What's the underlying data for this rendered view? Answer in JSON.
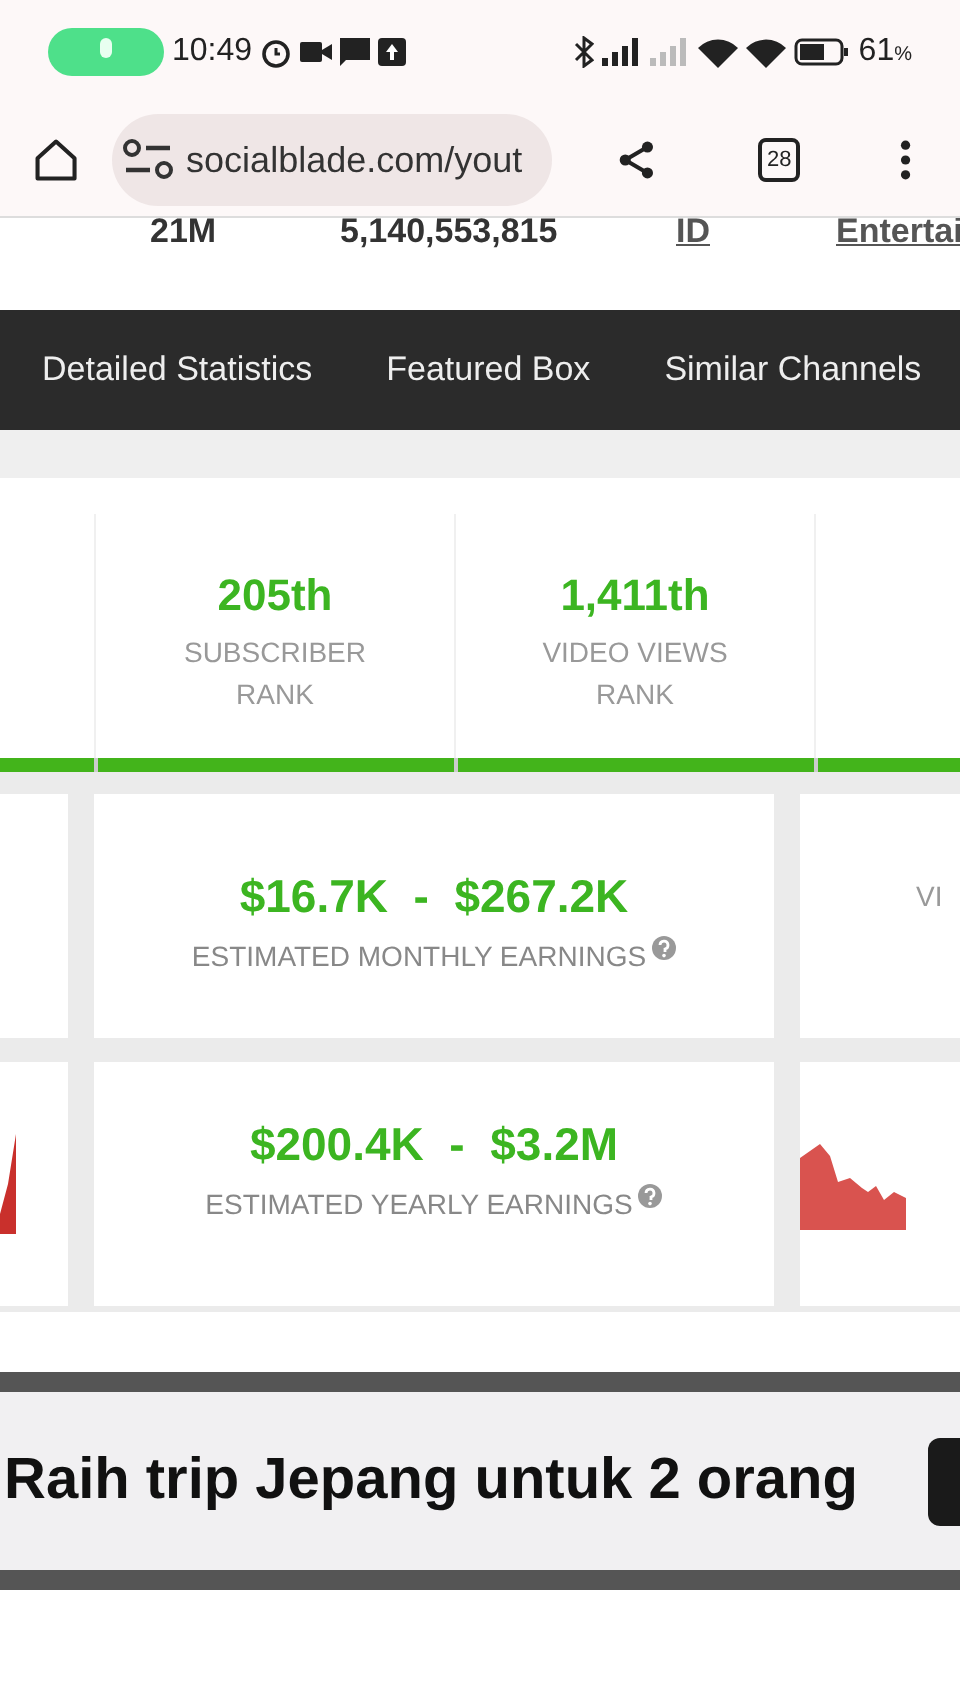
{
  "status_bar": {
    "time": "10:49",
    "battery": "61",
    "battery_unit": "%"
  },
  "browser": {
    "url": "socialblade.com/yout",
    "tab_count": "28"
  },
  "summary_row": [
    "21M",
    "5,140,553,815",
    "ID",
    "Entertai"
  ],
  "nav_tabs": [
    "Detailed Statistics",
    "Featured Box",
    "Similar Channels"
  ],
  "ranks": [
    {
      "value": "205th",
      "label": "SUBSCRIBER RANK"
    },
    {
      "value": "1,411th",
      "label": "VIDEO VIEWS RANK"
    }
  ],
  "earnings": [
    {
      "value": "$16.7K  -  $267.2K",
      "label": "ESTIMATED MONTHLY EARNINGS"
    },
    {
      "value": "$200.4K  -  $3.2M",
      "label": "ESTIMATED YEARLY EARNINGS"
    }
  ],
  "side_label": "VI",
  "ad": {
    "text": "Raih trip Jepang untuk 2 orang"
  }
}
